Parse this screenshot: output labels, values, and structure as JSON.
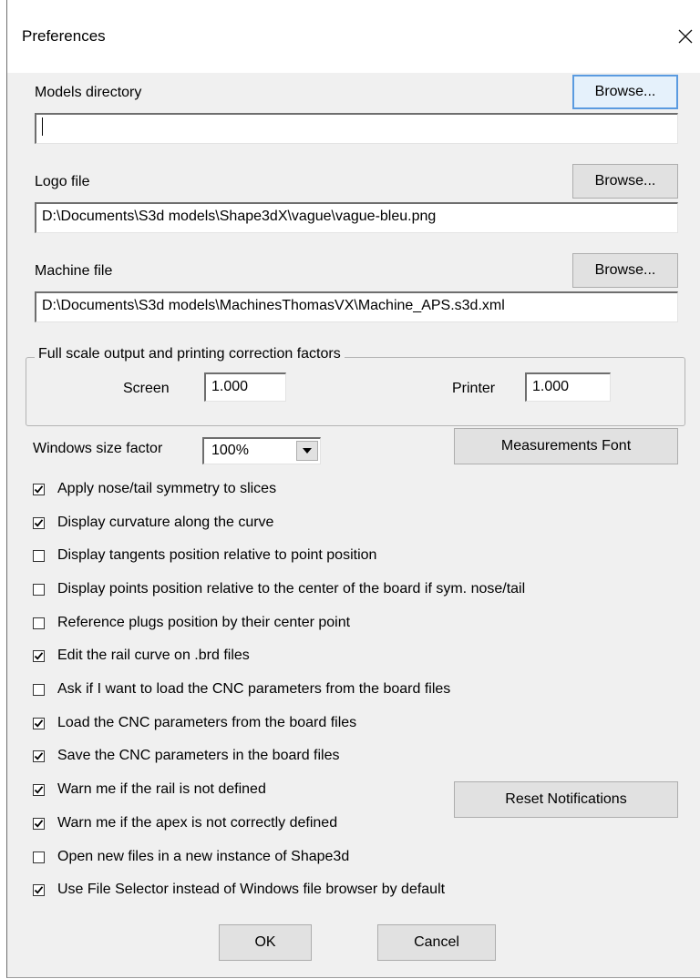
{
  "window": {
    "title": "Preferences",
    "close_label": "×"
  },
  "models": {
    "label": "Models directory",
    "browse": "Browse...",
    "value": ""
  },
  "logo": {
    "label": "Logo file",
    "browse": "Browse...",
    "value": "D:\\Documents\\S3d models\\Shape3dX\\vague\\vague-bleu.png"
  },
  "machine": {
    "label": "Machine file",
    "browse": "Browse...",
    "value": "D:\\Documents\\S3d models\\MachinesThomasVX\\Machine_APS.s3d.xml"
  },
  "correction": {
    "group_title": "Full scale output and printing correction factors",
    "screen_label": "Screen",
    "screen_value": "1.000",
    "printer_label": "Printer",
    "printer_value": "1.000"
  },
  "windows_size": {
    "label": "Windows size factor",
    "value": "100%"
  },
  "measurements_font_button": "Measurements Font",
  "reset_notifications_button": "Reset Notifications",
  "options": [
    {
      "label": "Apply nose/tail symmetry to slices",
      "checked": true
    },
    {
      "label": "Display curvature along the curve",
      "checked": true
    },
    {
      "label": "Display tangents position relative to point position",
      "checked": false
    },
    {
      "label": "Display points position relative to the center of the board if sym. nose/tail",
      "checked": false
    },
    {
      "label": "Reference plugs position by their center point",
      "checked": false
    },
    {
      "label": "Edit the rail curve on .brd files",
      "checked": true
    },
    {
      "label": "Ask if I want to load the CNC parameters from the board files",
      "checked": false
    },
    {
      "label": "Load the CNC parameters from the board files",
      "checked": true
    },
    {
      "label": "Save the CNC parameters in the board files",
      "checked": true
    },
    {
      "label": "Warn me if the rail is not defined",
      "checked": true
    },
    {
      "label": "Warn me if the apex is not correctly defined",
      "checked": true
    },
    {
      "label": "Open new files in a new instance of Shape3d",
      "checked": false
    },
    {
      "label": "Use File Selector instead of Windows file browser by default",
      "checked": true
    }
  ],
  "footer": {
    "ok": "OK",
    "cancel": "Cancel"
  }
}
